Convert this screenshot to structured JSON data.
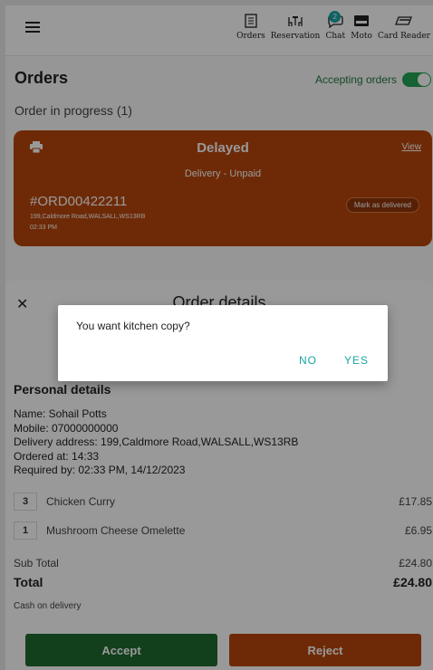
{
  "nav": {
    "items": [
      {
        "label": "Orders",
        "icon": "receipt-icon"
      },
      {
        "label": "Reservation",
        "icon": "reservation-icon"
      },
      {
        "label": "Chat",
        "icon": "chat-icon",
        "badge": "2"
      },
      {
        "label": "Moto",
        "icon": "moto-card-icon"
      },
      {
        "label": "Card Reader",
        "icon": "card-reader-icon"
      }
    ]
  },
  "orders": {
    "title": "Orders",
    "accepting_label": "Accepting orders",
    "accepting_on": true,
    "in_progress_label": "Order in progress (1)"
  },
  "order_card": {
    "status": "Delayed",
    "view_label": "View",
    "delivery_type": "Delivery - Unpaid",
    "order_number": "#ORD00422211",
    "address": "199,Caldmore Road,WALSALL,WS13RB",
    "time": "02:33 PM",
    "mark_delivered_label": "Mark as delivered"
  },
  "details": {
    "title": "Order details",
    "personal_title": "Personal details",
    "lines": [
      "Name: Sohail Potts",
      "Mobile: 07000000000",
      "Delivery address: 199,Caldmore Road,WALSALL,WS13RB",
      "Ordered at: 14:33",
      "Required by: 02:33 PM, 14/12/2023"
    ],
    "items": [
      {
        "qty": "3",
        "name": "Chicken Curry",
        "price": "£17.85"
      },
      {
        "qty": "1",
        "name": "Mushroom Cheese Omelette",
        "price": "£6.95"
      }
    ],
    "subtotal_label": "Sub Total",
    "subtotal": "£24.80",
    "total_label": "Total",
    "total": "£24.80",
    "payment": "Cash on delivery",
    "accept_label": "Accept",
    "reject_label": "Reject"
  },
  "dialog": {
    "message": "You want kitchen copy?",
    "no_label": "NO",
    "yes_label": "YES"
  },
  "colors": {
    "brand_orange": "#b8470c",
    "accept_green": "#1e6a30",
    "toggle_green": "#23a455",
    "accent_teal": "#1aa3a3"
  }
}
